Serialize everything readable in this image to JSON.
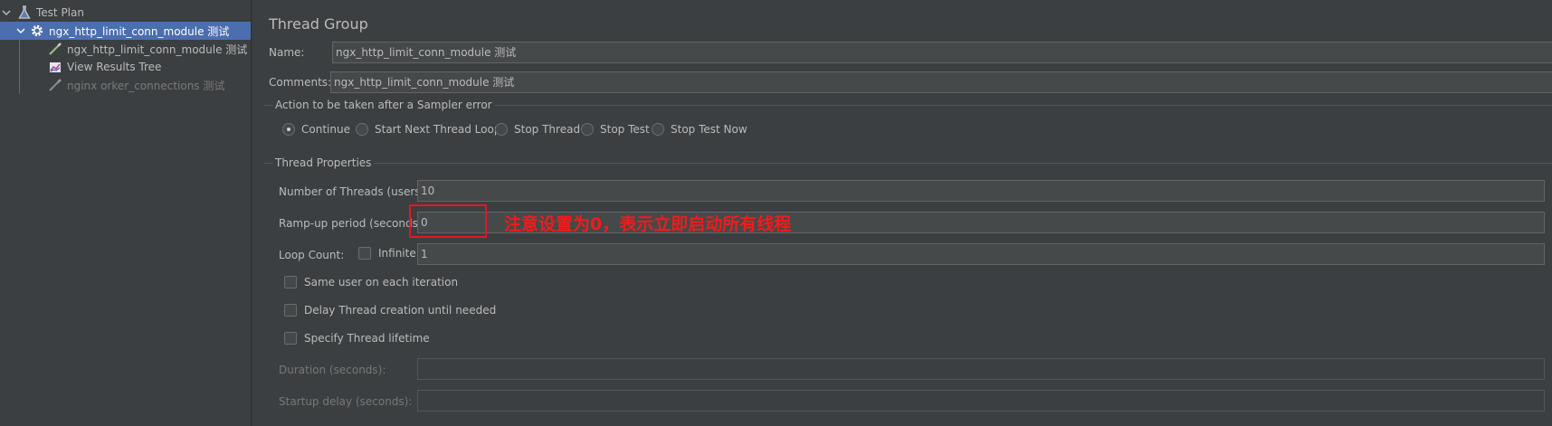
{
  "tree": {
    "items": [
      {
        "label": "Test Plan",
        "icon": "flask-icon"
      },
      {
        "label": "ngx_http_limit_conn_module 测试",
        "icon": "gear-icon"
      },
      {
        "label": "ngx_http_limit_conn_module 测试",
        "icon": "pipette-icon"
      },
      {
        "label": "View Results Tree",
        "icon": "chart-icon"
      },
      {
        "label": "nginx orker_connections 测试",
        "icon": "pipette-icon"
      }
    ]
  },
  "panel": {
    "title": "Thread Group",
    "name_label": "Name:",
    "name_value": "ngx_http_limit_conn_module 测试",
    "comments_label": "Comments:",
    "comments_value": "ngx_http_limit_conn_module 测试",
    "sampler_error": {
      "title": "Action to be taken after a Sampler error",
      "options": [
        "Continue",
        "Start Next Thread Loop",
        "Stop Thread",
        "Stop Test",
        "Stop Test Now"
      ],
      "selected": "Continue"
    },
    "thread_properties": {
      "title": "Thread Properties",
      "threads_label": "Number of Threads (users):",
      "threads_value": "10",
      "rampup_label": "Ramp-up period (seconds):",
      "rampup_value": "0",
      "loop_label": "Loop Count:",
      "infinite_label": "Infinite",
      "loop_value": "1",
      "same_user_label": "Same user on each iteration",
      "delay_label": "Delay Thread creation until needed",
      "lifetime_label": "Specify Thread lifetime",
      "duration_label": "Duration (seconds):",
      "startup_label": "Startup delay (seconds):"
    }
  },
  "annotation": {
    "text": "注意设置为0，表示立即启动所有线程",
    "color": "#f21b1b"
  },
  "colors": {
    "background": "#3c3f41",
    "selected": "#4b6eaf",
    "input_bg": "#45494a"
  }
}
